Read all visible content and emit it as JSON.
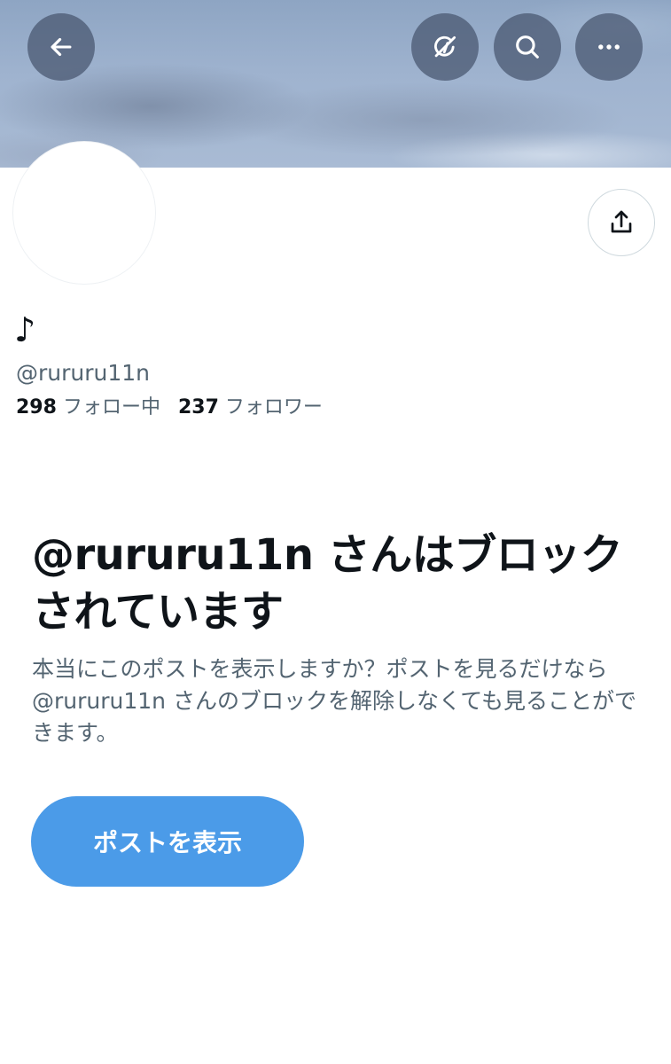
{
  "header": {
    "back_icon": "arrow-left-icon",
    "grok_icon": "grok-icon",
    "search_icon": "search-icon",
    "more_icon": "more-horizontal-icon"
  },
  "profile": {
    "display_name": "♪",
    "handle": "@rururu11n",
    "following_count": "298",
    "following_label": "フォロー中",
    "followers_count": "237",
    "followers_label": "フォロワー",
    "share_icon": "share-icon"
  },
  "blocked_notice": {
    "title": "@rururu11n さんはブロックされています",
    "body": "本当にこのポストを表示しますか？ポストを見るだけなら @rururu11n さんのブロックを解除しなくても見ることができます。",
    "view_button_label": "ポストを表示"
  },
  "colors": {
    "accent": "#4b9be8",
    "text_primary": "#0f1419",
    "text_secondary": "#536471"
  }
}
